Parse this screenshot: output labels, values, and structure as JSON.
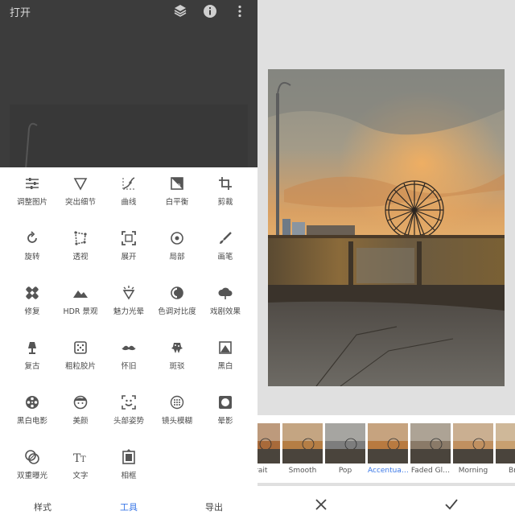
{
  "header": {
    "open_label": "打开"
  },
  "tools": [
    {
      "label": "调整图片",
      "icon": "tune-icon"
    },
    {
      "label": "突出细节",
      "icon": "details-triangle-icon"
    },
    {
      "label": "曲线",
      "icon": "curves-icon"
    },
    {
      "label": "白平衡",
      "icon": "white-balance-icon"
    },
    {
      "label": "剪裁",
      "icon": "crop-icon"
    },
    {
      "label": "旋转",
      "icon": "rotate-icon"
    },
    {
      "label": "透视",
      "icon": "perspective-icon"
    },
    {
      "label": "展开",
      "icon": "expand-icon"
    },
    {
      "label": "局部",
      "icon": "selective-icon"
    },
    {
      "label": "画笔",
      "icon": "brush-icon"
    },
    {
      "label": "修复",
      "icon": "healing-icon"
    },
    {
      "label": "HDR 景观",
      "icon": "hdr-mountain-icon"
    },
    {
      "label": "魅力光晕",
      "icon": "glamour-glow-icon"
    },
    {
      "label": "色调对比度",
      "icon": "tonal-contrast-icon"
    },
    {
      "label": "戏剧效果",
      "icon": "drama-cloud-icon"
    },
    {
      "label": "复古",
      "icon": "vintage-lamp-icon"
    },
    {
      "label": "粗粒胶片",
      "icon": "grainy-film-icon"
    },
    {
      "label": "怀旧",
      "icon": "mustache-icon"
    },
    {
      "label": "斑驳",
      "icon": "grunge-icon"
    },
    {
      "label": "黑白",
      "icon": "black-white-icon"
    },
    {
      "label": "黑白电影",
      "icon": "noir-film-reel-icon"
    },
    {
      "label": "美颜",
      "icon": "face-icon"
    },
    {
      "label": "头部姿势",
      "icon": "head-pose-icon"
    },
    {
      "label": "镜头模糊",
      "icon": "lens-blur-icon"
    },
    {
      "label": "晕影",
      "icon": "vignette-icon"
    },
    {
      "label": "双重曝光",
      "icon": "double-exposure-icon"
    },
    {
      "label": "文字",
      "icon": "text-icon"
    },
    {
      "label": "相框",
      "icon": "frames-icon"
    }
  ],
  "bottom_nav": {
    "looks": "样式",
    "tools": "工具",
    "export": "导出"
  },
  "looks": [
    {
      "label": "trait",
      "tone": "#a86a3a"
    },
    {
      "label": "Smooth",
      "tone": "#b57e45"
    },
    {
      "label": "Pop",
      "tone": "#7d7d7d"
    },
    {
      "label": "Accentua…",
      "tone": "#b87a40"
    },
    {
      "label": "Faded Gl…",
      "tone": "#8a7a68"
    },
    {
      "label": "Morning",
      "tone": "#c09060"
    },
    {
      "label": "Brig",
      "tone": "#c8a070"
    }
  ],
  "active_look": "Accentua…",
  "accent_color": "#3b78e7"
}
